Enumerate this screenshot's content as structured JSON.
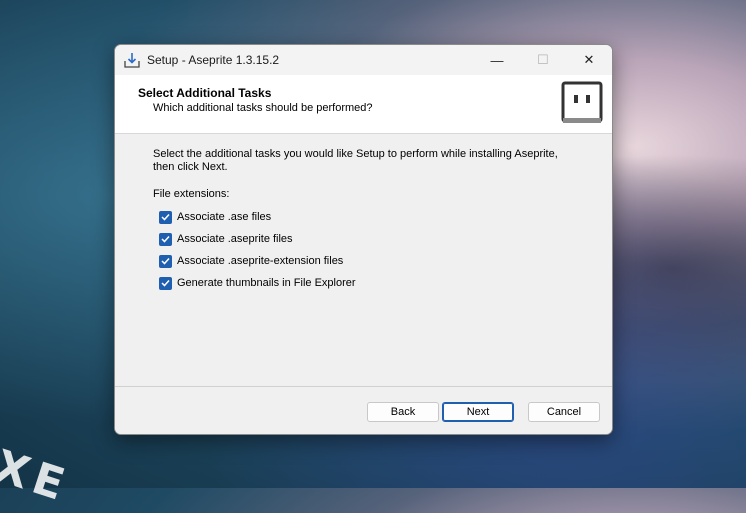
{
  "wallpaper": {
    "text": "XE"
  },
  "window": {
    "title": "Setup - Aseprite 1.3.15.2",
    "controls": {
      "minimize": "—",
      "maximize": "☐",
      "close": "✕"
    }
  },
  "header": {
    "title": "Select Additional Tasks",
    "subtitle": "Which additional tasks should be performed?"
  },
  "content": {
    "description": "Select the additional tasks you would like Setup to perform while installing Aseprite, then click Next.",
    "section_label": "File extensions:",
    "tasks": [
      {
        "label": "Associate .ase files",
        "checked": true
      },
      {
        "label": "Associate .aseprite files",
        "checked": true
      },
      {
        "label": "Associate .aseprite-extension files",
        "checked": true
      },
      {
        "label": "Generate thumbnails in File Explorer",
        "checked": true
      }
    ]
  },
  "footer": {
    "back_label": "Back",
    "next_label": "Next",
    "cancel_label": "Cancel"
  },
  "colors": {
    "accent": "#1f5fb0"
  },
  "icons": {
    "app": "installer-download-icon",
    "logo": "aseprite-logo-icon",
    "check": "checkmark-icon"
  }
}
